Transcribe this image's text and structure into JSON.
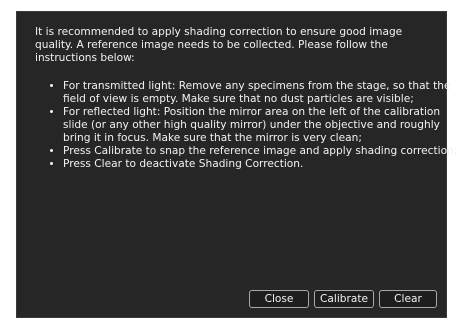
{
  "dialog": {
    "intro": "It is recommended to apply shading correction to ensure good image quality. A reference image needs to be collected. Please follow the instructions below:",
    "instructions": [
      "For transmitted light: Remove any specimens from the stage, so that the field of view is empty. Make sure that no dust particles are visible;",
      "For reflected light: Position the mirror area on the left of the calibration slide (or any other high quality mirror) under the objective and roughly bring it in focus. Make sure that the mirror is very clean;",
      "Press Calibrate to snap the reference image and apply shading correction;",
      "Press Clear to deactivate Shading Correction."
    ]
  },
  "buttons": {
    "close_label": "Close",
    "calibrate_label": "Calibrate",
    "clear_label": "Clear"
  },
  "colors": {
    "dialog_background": "#262626",
    "text": "#f2f2f2",
    "button_border": "#a8a8a8"
  }
}
